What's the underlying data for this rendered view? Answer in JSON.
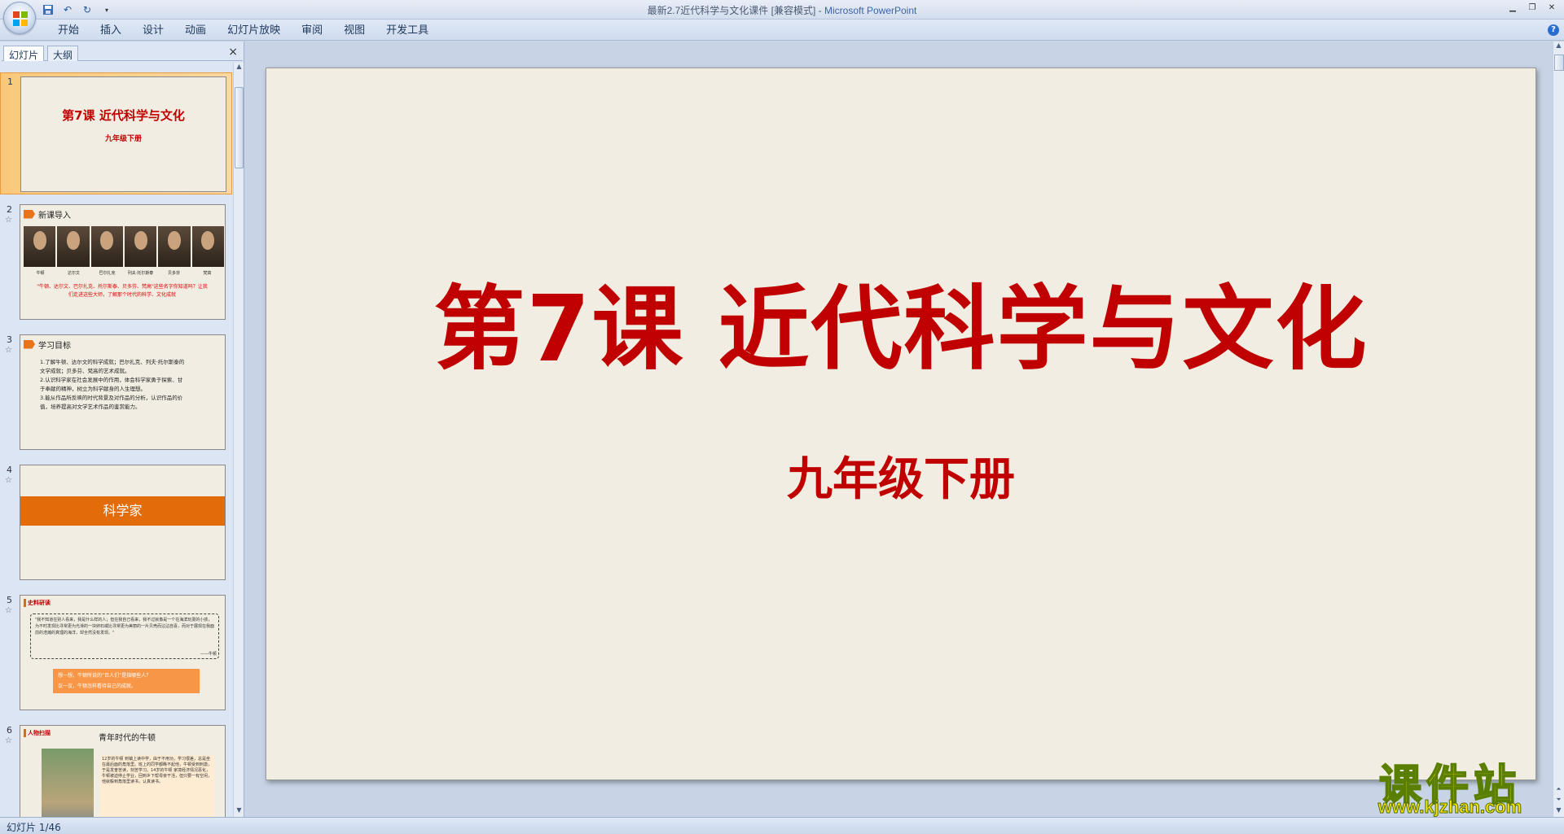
{
  "window": {
    "title_doc": "最新2.7近代科学与文化课件 [兼容模式] - ",
    "title_app": "Microsoft PowerPoint"
  },
  "ribbon": {
    "tabs": [
      "开始",
      "插入",
      "设计",
      "动画",
      "幻灯片放映",
      "审阅",
      "视图",
      "开发工具"
    ]
  },
  "panel": {
    "tabs": [
      "幻灯片",
      "大纲"
    ],
    "close": "×"
  },
  "thumbnails": [
    {
      "num": "1",
      "title": "第7课 近代科学与文化",
      "subtitle": "九年级下册"
    },
    {
      "num": "2",
      "heading": "新课导入",
      "names": [
        "牛顿",
        "达尔文",
        "巴尔扎克",
        "列夫·托尔斯泰",
        "贝多芬",
        "梵高"
      ],
      "text": "\"牛顿、达尔文、巴尔扎克、托尔斯泰、贝多芬、梵高\"这些名字你知道吗？让我们走进这些大师，了解那个时代的科学、文化成就"
    },
    {
      "num": "3",
      "heading": "学习目标",
      "lines": [
        "1.了解牛顿、达尔文的科学成就；巴尔扎克、列夫·托尔斯泰的",
        "文学成就；贝多芬、梵高的艺术成就。",
        "2.认识科学家在社会发展中的作用，体会科学家勇于探索、甘",
        "于奉献的精神，树立为科学献身的人生理想。",
        "3.能从作品所反映的时代背景及对作品的分析，认识作品的价",
        "值，培养提高对文学艺术作品的鉴赏能力。"
      ]
    },
    {
      "num": "4",
      "band": "科学家"
    },
    {
      "num": "5",
      "tag": "史料研读",
      "quote": "\"我不知道在别人看来，我是什么样的人；但在我自己看来，我不过就像是一个在海滨玩耍的小孩，为不时发现比寻常更为光滑的一块卵石或比寻常更为美丽的一片贝壳而沾沾自喜，而对于展现在我面前的浩瀚的真理的海洋，却全然没有发现。\"",
      "by": "——牛顿",
      "box": [
        "想一想，牛顿所说的“巨人们”是指哪些人？",
        "议一议，牛顿怎样看待自己的成就。"
      ]
    },
    {
      "num": "6",
      "tag": "人物扫描",
      "heading": "青年时代的牛顿",
      "text": "12岁的牛顿 到镇上读中学，由于不用功，学习很差，总是坐在最后面的角落里。班上的同学都瞧不起他，牛顿受到刺激，于是发奋苦读，刻苦学习。14岁的牛顿 家境经济情况恶化，牛顿被迫停止学业，回到乡下帮母亲干活，但只要一有空闲，他就躲到角落里读书，认真读书。"
    }
  ],
  "slide": {
    "title": "第7课  近代科学与文化",
    "subtitle": "九年级下册"
  },
  "watermark": {
    "top": "课件站",
    "url": "www.kjzhan.com"
  },
  "status": {
    "slide_info": "幻灯片 1/46"
  },
  "colors": {
    "title_red": "#c00000",
    "accent_orange": "#e36c0a",
    "slide_bg": "#f1ede2",
    "workspace": "#c8d4e6"
  }
}
